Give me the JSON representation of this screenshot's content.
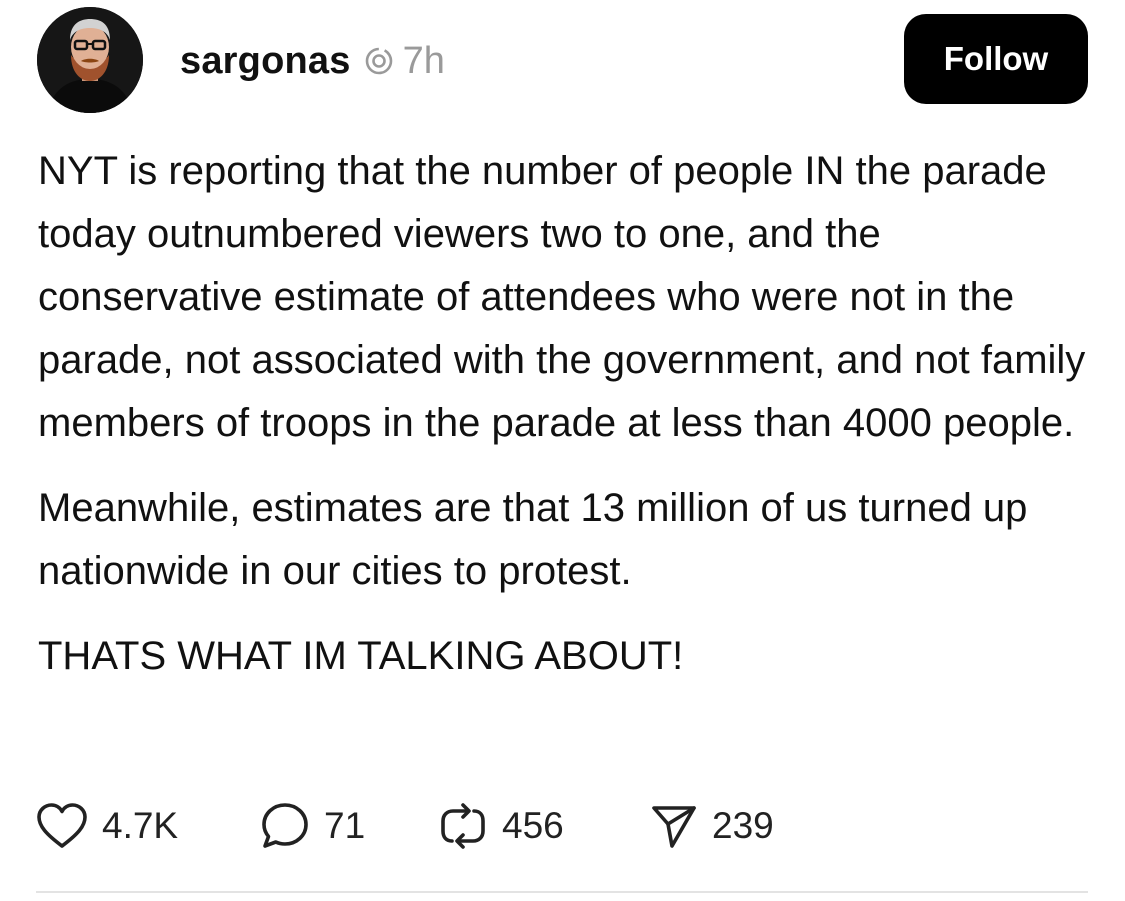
{
  "post": {
    "author": {
      "username": "sargonas",
      "avatar_icon": "user-avatar-photo",
      "badge_icon": "threads-icon"
    },
    "timestamp": "7h",
    "follow_label": "Follow",
    "paragraphs": [
      "NYT is reporting that the number of people IN the parade today outnumbered viewers two to one, and the conservative estimate of attendees who were not in the parade, not associated with the government, and not family members of troops in the parade at less than 4000 people.",
      "Meanwhile, estimates are that 13 million of us turned up nationwide in our cities to protest.",
      "THATS WHAT IM TALKING ABOUT!"
    ],
    "actions": {
      "likes": {
        "icon": "heart-icon",
        "count": "4.7K"
      },
      "replies": {
        "icon": "comment-icon",
        "count": "71"
      },
      "reposts": {
        "icon": "repost-icon",
        "count": "456"
      },
      "shares": {
        "icon": "send-icon",
        "count": "239"
      }
    }
  },
  "colors": {
    "text": "#111111",
    "muted": "#9a9a9a",
    "button_bg": "#000000",
    "button_text": "#ffffff",
    "divider": "#e3e3e3"
  }
}
